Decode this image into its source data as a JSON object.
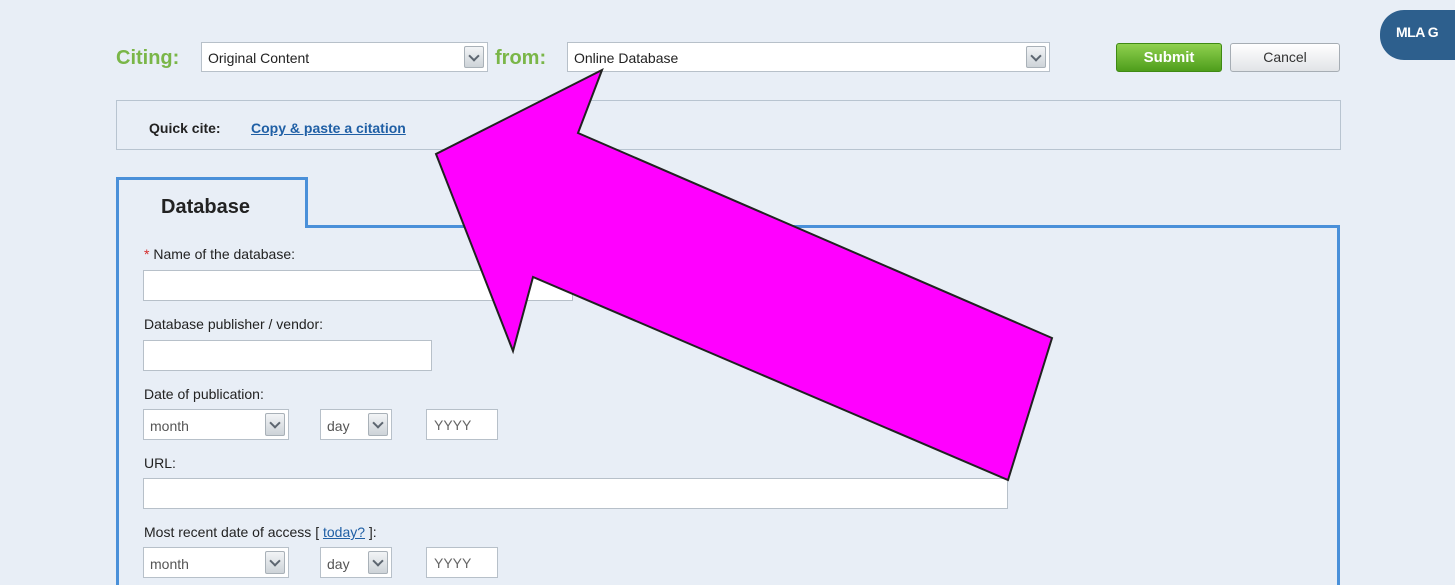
{
  "header": {
    "citing_label": "Citing:",
    "citing_value": "Original Content",
    "from_label": "from:",
    "from_value": "Online Database",
    "submit_label": "Submit",
    "cancel_label": "Cancel",
    "mla_tab_label": "MLA G"
  },
  "quick_cite": {
    "label": "Quick cite:",
    "link": "Copy & paste a citation"
  },
  "panel": {
    "tab_label": "Database"
  },
  "form": {
    "required_mark": "*",
    "db_name_label": "Name of the database:",
    "db_name_value": "",
    "publisher_label": "Database publisher / vendor:",
    "publisher_value": "",
    "pub_date_label": "Date of publication:",
    "pub_month": "month",
    "pub_day": "day",
    "pub_year_placeholder": "YYYY",
    "url_label": "URL:",
    "url_value": "",
    "access_label_prefix": "Most recent date of access [ ",
    "access_today_link": "today?",
    "access_label_suffix": " ]:",
    "access_month": "month",
    "access_day": "day",
    "access_year_placeholder": "YYYY"
  },
  "colors": {
    "accent_green": "#7ab648",
    "panel_border": "#4a90d9",
    "arrow_fill": "#ff00ff",
    "link": "#1f5fa5"
  }
}
